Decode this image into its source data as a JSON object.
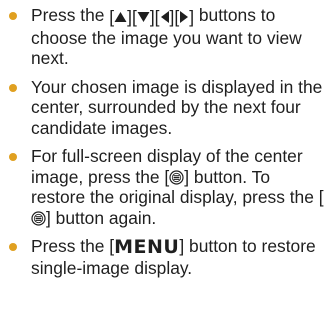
{
  "instructions": {
    "items": [
      {
        "before": "Press the ",
        "after": " buttons to choose the image you want to view next."
      },
      {
        "text": "Your chosen image is displayed in the center, surrounded by the next four candidate images."
      },
      {
        "before": "For full-screen display of the center image, press the ",
        "middle": " button. To restore the original display, press the ",
        "after": " button again."
      },
      {
        "before": "Press the ",
        "menu_label": "MENU",
        "after": " button to restore single-image display."
      }
    ],
    "bracket_open": "[",
    "bracket_close": "]",
    "arrow_icons": [
      "up-arrow-icon",
      "down-arrow-icon",
      "left-arrow-icon",
      "right-arrow-icon"
    ],
    "func_set_icon": "func-set-icon",
    "bullet_color": "#e0a020"
  }
}
